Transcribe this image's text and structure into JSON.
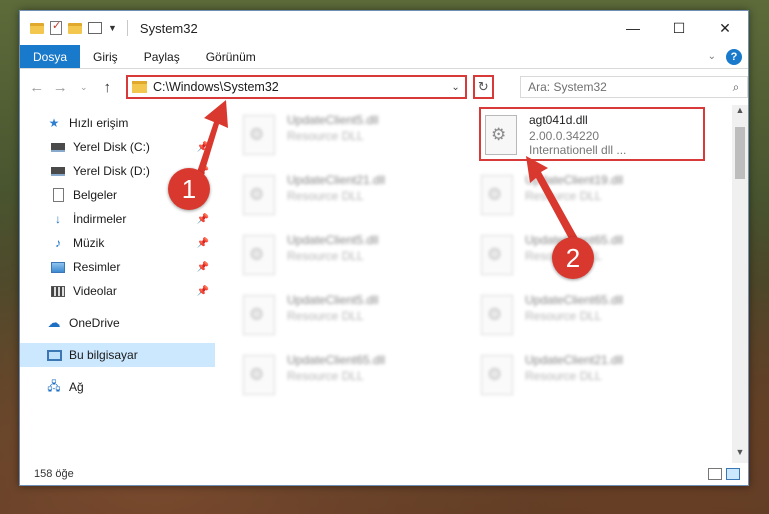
{
  "window": {
    "title": "System32"
  },
  "ribbon": {
    "file": "Dosya",
    "tabs": [
      "Giriş",
      "Paylaş",
      "Görünüm"
    ]
  },
  "address": {
    "path": "C:\\Windows\\System32"
  },
  "search": {
    "placeholder": "Ara: System32"
  },
  "sidebar": {
    "quick_access": "Hızlı erişim",
    "items": [
      {
        "label": "Yerel Disk (C:)",
        "icon": "drive-icon",
        "pinned": true
      },
      {
        "label": "Yerel Disk (D:)",
        "icon": "drive-icon",
        "pinned": true
      },
      {
        "label": "Belgeler",
        "icon": "document-icon",
        "pinned": true
      },
      {
        "label": "İndirmeler",
        "icon": "download-icon",
        "pinned": true
      },
      {
        "label": "Müzik",
        "icon": "music-icon",
        "pinned": true
      },
      {
        "label": "Resimler",
        "icon": "pictures-icon",
        "pinned": true
      },
      {
        "label": "Videolar",
        "icon": "videos-icon",
        "pinned": true
      }
    ],
    "onedrive": "OneDrive",
    "this_pc": "Bu bilgisayar",
    "network": "Ağ"
  },
  "files": [
    {
      "name": "UpdateClient5.dll",
      "sub": "Resource DLL"
    },
    {
      "name": "agt041d.dll",
      "sub": "2.00.0.34220",
      "sub2": "Internationell dll ...",
      "selected": true
    },
    {
      "name": "UpdateClient21.dll",
      "sub": "Resource DLL"
    },
    {
      "name": "UpdateClient19.dll",
      "sub": "Resource DLL"
    },
    {
      "name": "UpdateClient5.dll",
      "sub": "Resource DLL"
    },
    {
      "name": "UpdateClient65.dll",
      "sub": "Resource DLL"
    },
    {
      "name": "UpdateClient5.dll",
      "sub": "Resource DLL"
    },
    {
      "name": "UpdateClient65.dll",
      "sub": "Resource DLL"
    },
    {
      "name": "UpdateClient65.dll",
      "sub": "Resource DLL"
    },
    {
      "name": "UpdateClient21.dll",
      "sub": "Resource DLL"
    }
  ],
  "status": {
    "count": "158 öğe"
  },
  "callouts": [
    "1",
    "2"
  ],
  "colors": {
    "accent": "#1979ca",
    "highlight": "#d83a3a"
  }
}
